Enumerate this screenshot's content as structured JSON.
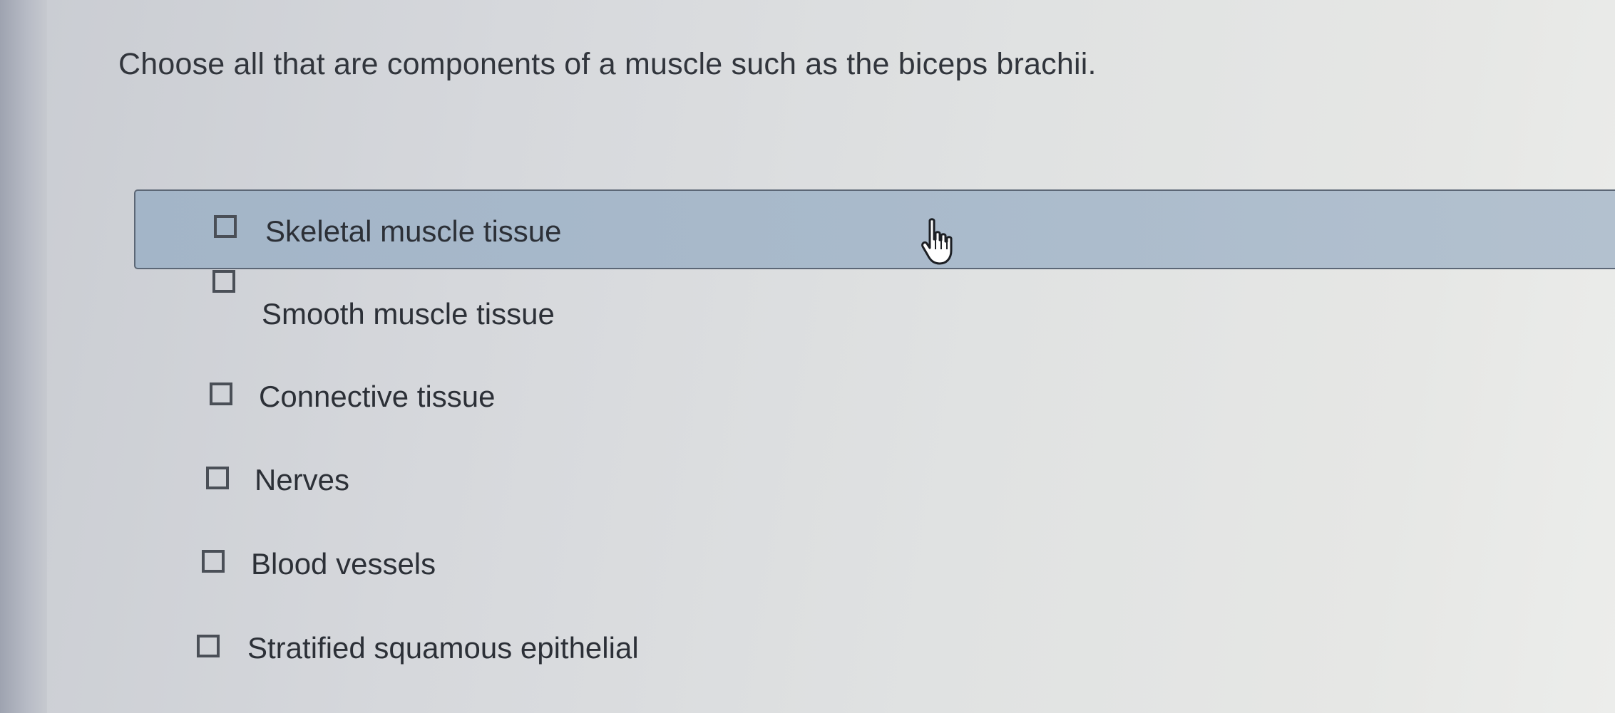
{
  "question": {
    "text": "Choose all that are components of a muscle such as the biceps brachii."
  },
  "options": [
    {
      "label": "Skeletal muscle tissue",
      "checked": false,
      "hovered": true
    },
    {
      "label": "Smooth muscle tissue",
      "checked": false
    },
    {
      "label": "Connective tissue",
      "checked": false
    },
    {
      "label": "Nerves",
      "checked": false
    },
    {
      "label": "Blood vessels",
      "checked": false
    },
    {
      "label": "Stratified squamous epithelial",
      "checked": false
    }
  ],
  "cursor": {
    "icon": "hand-pointer-icon"
  },
  "colors": {
    "highlight": "#a9bacb",
    "text": "#2c3037",
    "checkbox_border": "#4a4f57"
  }
}
